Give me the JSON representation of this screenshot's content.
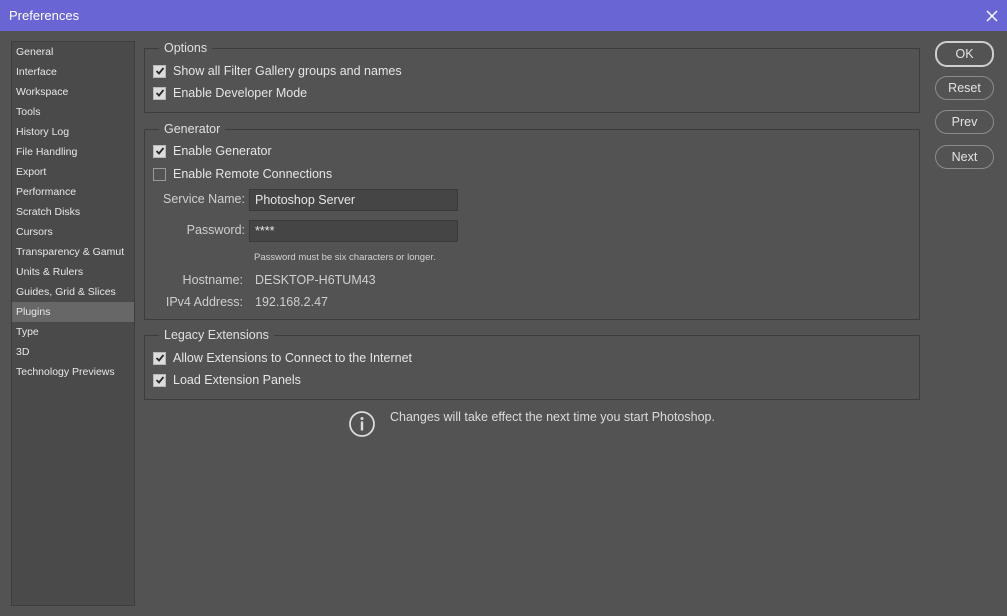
{
  "window": {
    "title": "Preferences",
    "close_icon": "close-icon"
  },
  "sidebar": {
    "items": [
      {
        "label": "General"
      },
      {
        "label": "Interface"
      },
      {
        "label": "Workspace"
      },
      {
        "label": "Tools"
      },
      {
        "label": "History Log"
      },
      {
        "label": "File Handling"
      },
      {
        "label": "Export"
      },
      {
        "label": "Performance"
      },
      {
        "label": "Scratch Disks"
      },
      {
        "label": "Cursors"
      },
      {
        "label": "Transparency & Gamut"
      },
      {
        "label": "Units & Rulers"
      },
      {
        "label": "Guides, Grid & Slices"
      },
      {
        "label": "Plugins"
      },
      {
        "label": "Type"
      },
      {
        "label": "3D"
      },
      {
        "label": "Technology Previews"
      }
    ],
    "selected": "Plugins"
  },
  "options": {
    "legend": "Options",
    "show_filter_gallery": {
      "label": "Show all Filter Gallery groups and names",
      "checked": true
    },
    "developer_mode": {
      "label": "Enable Developer Mode",
      "checked": true
    }
  },
  "generator": {
    "legend": "Generator",
    "enable_generator": {
      "label": "Enable Generator",
      "checked": true
    },
    "remote_connections": {
      "label": "Enable Remote Connections",
      "checked": false
    },
    "service_name_label": "Service Name:",
    "service_name_value": "Photoshop Server",
    "password_label": "Password:",
    "password_value": "****",
    "password_hint": "Password must be six characters or longer.",
    "hostname_label": "Hostname:",
    "hostname_value": "DESKTOP-H6TUM43",
    "ipv4_label": "IPv4 Address:",
    "ipv4_value": "192.168.2.47"
  },
  "legacy": {
    "legend": "Legacy Extensions",
    "allow_internet": {
      "label": "Allow Extensions to Connect to the Internet",
      "checked": true
    },
    "load_panels": {
      "label": "Load Extension Panels",
      "checked": true
    }
  },
  "notice": {
    "text": "Changes will take effect the next time you start Photoshop.",
    "icon": "info-icon"
  },
  "buttons": {
    "ok": "OK",
    "reset": "Reset",
    "prev": "Prev",
    "next": "Next"
  },
  "colors": {
    "titlebar": "#6a65d4",
    "background": "#535353",
    "sidebar": "#4a4a4a",
    "selected": "#676767"
  }
}
